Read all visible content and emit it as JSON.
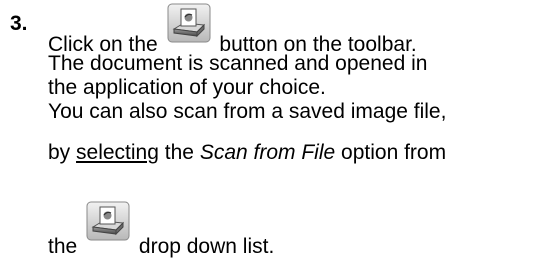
{
  "step": {
    "number": "3.",
    "line1_before": "Click on the",
    "line1_after": "button on the toolbar.",
    "result_line1": "The document is scanned and opened in",
    "result_line2": "the application of your choice.",
    "note_line1": "You can also scan from a saved image file,",
    "note_line2_by": "by",
    "note_line2_underlined": "selecting",
    "note_line2_middle": "the",
    "note_line2_option": "Scan from File",
    "note_line2_end": "option from",
    "note_line3_before": "the",
    "note_line3_after": "drop down list."
  },
  "icons": {
    "toolbar_button_icon": "scan-to-application-icon",
    "dropdown_icon": "scan-to-application-icon"
  }
}
